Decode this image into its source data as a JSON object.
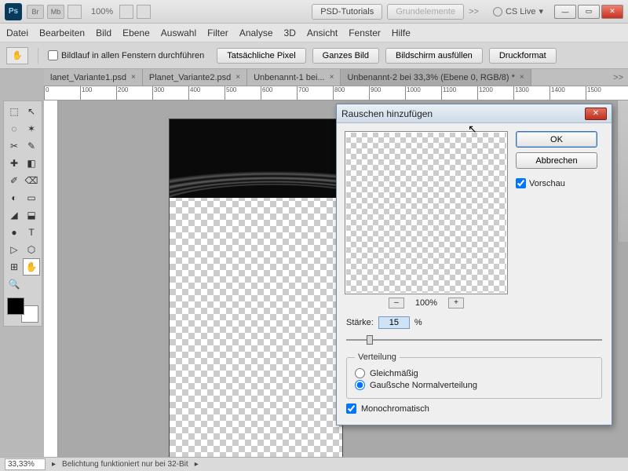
{
  "window": {
    "app_badge": "Ps",
    "mini_buttons": [
      "Br",
      "Mb"
    ],
    "zoom_pct": "100%",
    "workspace_tabs": [
      "PSD-Tutorials",
      "Grundelemente"
    ],
    "more_glyph": ">>",
    "cs_live": "CS Live",
    "win_min": "—",
    "win_max": "▭",
    "win_close": "✕"
  },
  "menu": [
    "Datei",
    "Bearbeiten",
    "Bild",
    "Ebene",
    "Auswahl",
    "Filter",
    "Analyse",
    "3D",
    "Ansicht",
    "Fenster",
    "Hilfe"
  ],
  "optionsbar": {
    "scroll_all": "Bildlauf in allen Fenstern durchführen",
    "buttons": [
      "Tatsächliche Pixel",
      "Ganzes Bild",
      "Bildschirm ausfüllen",
      "Druckformat"
    ]
  },
  "tabs": [
    {
      "label": "lanet_Variante1.psd",
      "close": "×",
      "active": false
    },
    {
      "label": "Planet_Variante2.psd",
      "close": "×",
      "active": false
    },
    {
      "label": "Unbenannt-1 bei...",
      "close": "×",
      "active": false
    },
    {
      "label": "Unbenannt-2 bei 33,3% (Ebene 0, RGB/8) *",
      "close": "×",
      "active": true
    }
  ],
  "tabs_more": ">>",
  "ruler_marks": [
    "0",
    "100",
    "200",
    "300",
    "400",
    "500",
    "600",
    "700",
    "800",
    "900",
    "1000",
    "1100",
    "1200",
    "1300",
    "1400",
    "1500"
  ],
  "tools": [
    "⬚",
    "↖",
    "◌",
    "✶",
    "✂",
    "✎",
    "✚",
    "◧",
    "✐",
    "⌫",
    "◐",
    "▭",
    "◢",
    "⬓",
    "●",
    "T",
    "▷",
    "⬡",
    "⊞",
    "✋",
    "🔍"
  ],
  "status": {
    "zoom": "33,33%",
    "msg": "Belichtung funktioniert nur bei 32-Bit",
    "arrow": "▸"
  },
  "dialog": {
    "title": "Rauschen hinzufügen",
    "ok": "OK",
    "cancel": "Abbrechen",
    "preview_cb": "Vorschau",
    "zoom_out": "–",
    "zoom_pct": "100%",
    "zoom_in": "+",
    "amount_label": "Stärke:",
    "amount_value": "15",
    "amount_unit": "%",
    "dist_legend": "Verteilung",
    "dist_uniform": "Gleichmäßig",
    "dist_gaussian": "Gaußsche Normalverteilung",
    "mono": "Monochromatisch"
  }
}
